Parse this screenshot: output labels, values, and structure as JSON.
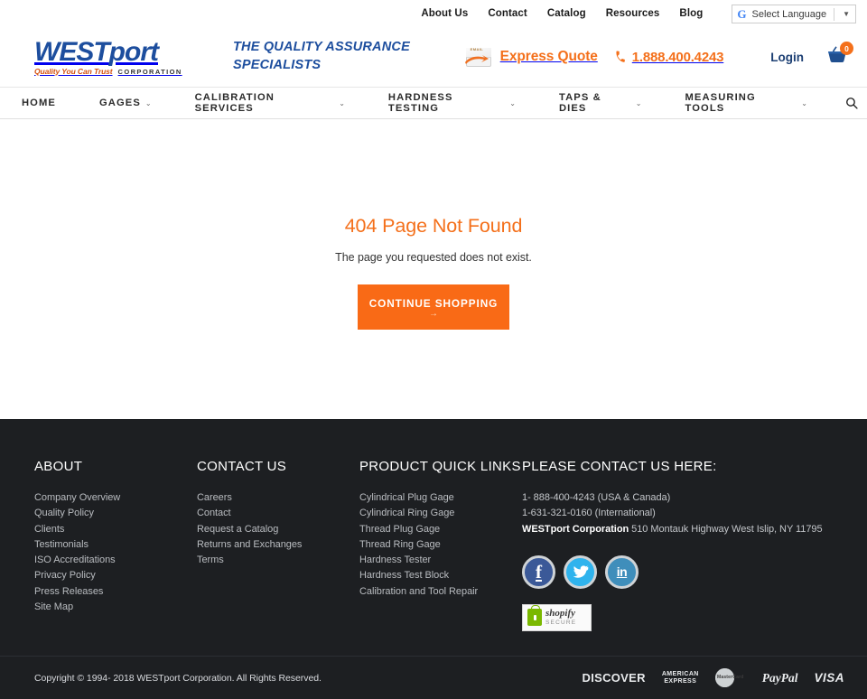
{
  "topbar": {
    "links": [
      {
        "label": "About Us"
      },
      {
        "label": "Contact"
      },
      {
        "label": "Catalog"
      },
      {
        "label": "Resources"
      },
      {
        "label": "Blog"
      }
    ],
    "translate": {
      "icon": "google-g-icon",
      "label": "Select Language",
      "caret": "▼"
    }
  },
  "header": {
    "logo": {
      "west": "WEST",
      "port": "port",
      "tagline": "Quality You Can Trust",
      "corp": "CORPORATION"
    },
    "tagline": "THE QUALITY ASSURANCE SPECIALISTS",
    "express_quote": {
      "icon": "email-envelope-icon",
      "icon_text": "EMAIL",
      "label": "Express Quote"
    },
    "phone": {
      "icon": "phone-icon",
      "number": "1.888.400.4243"
    },
    "login_label": "Login",
    "cart": {
      "icon": "shopping-cart-icon",
      "count": "0"
    }
  },
  "nav": {
    "items": [
      {
        "label": "HOME",
        "has_dropdown": false
      },
      {
        "label": "GAGES",
        "has_dropdown": true
      },
      {
        "label": "CALIBRATION SERVICES",
        "has_dropdown": true
      },
      {
        "label": "HARDNESS TESTING",
        "has_dropdown": true
      },
      {
        "label": "TAPS & DIES",
        "has_dropdown": true
      },
      {
        "label": "MEASURING TOOLS",
        "has_dropdown": true
      }
    ],
    "caret": "⌄",
    "search_icon": "search-icon"
  },
  "main": {
    "error_title": "404 Page Not Found",
    "error_message": "The page you requested does not exist.",
    "cta_label": "CONTINUE SHOPPING",
    "cta_arrow": "→"
  },
  "footer": {
    "about": {
      "heading": "ABOUT",
      "links": [
        "Company Overview",
        "Quality Policy",
        "Clients",
        "Testimonials",
        "ISO Accreditations",
        "Privacy Policy",
        "Press Releases",
        "Site Map"
      ]
    },
    "contact": {
      "heading": "CONTACT US",
      "links": [
        "Careers",
        "Contact",
        "Request a Catalog",
        "Returns and Exchanges",
        "Terms"
      ]
    },
    "products": {
      "heading": "PRODUCT QUICK LINKS",
      "links": [
        "Cylindrical Plug Gage",
        "Cylindrical Ring Gage",
        "Thread Plug Gage",
        "Thread Ring Gage",
        "Hardness Tester",
        "Hardness Test Block",
        "Calibration and Tool Repair"
      ]
    },
    "info": {
      "heading": "PLEASE CONTACT US HERE:",
      "phone_usa": "1- 888-400-4243 (USA & Canada)",
      "phone_intl": "1-631-321-0160 (International)",
      "company": "WESTport Corporation",
      "address": " 510 Montauk Highway West Islip, NY 11795",
      "socials": [
        {
          "name": "facebook-icon",
          "glyph": "f"
        },
        {
          "name": "twitter-icon",
          "glyph": "🐦"
        },
        {
          "name": "linkedin-icon",
          "glyph": "in"
        }
      ],
      "shopify": {
        "icon": "green-lock-icon",
        "name": "shopify",
        "sub": "SECURE"
      }
    }
  },
  "bottombar": {
    "copyright": "Copyright © 1994- 2018 WESTport Corporation. All Rights Reserved.",
    "payments": [
      {
        "name": "discover-logo",
        "label": "DISCOVER"
      },
      {
        "name": "amex-logo",
        "label": "AMERICAN EXPRESS"
      },
      {
        "name": "mastercard-logo",
        "label": "MasterCard"
      },
      {
        "name": "paypal-logo",
        "label": "PayPal"
      },
      {
        "name": "visa-logo",
        "label": "VISA"
      }
    ]
  },
  "colors": {
    "accent_orange": "#f4701b",
    "cta_orange": "#f96a16",
    "brand_blue": "#1d4e9e",
    "footer_dark": "#1d1f22"
  }
}
